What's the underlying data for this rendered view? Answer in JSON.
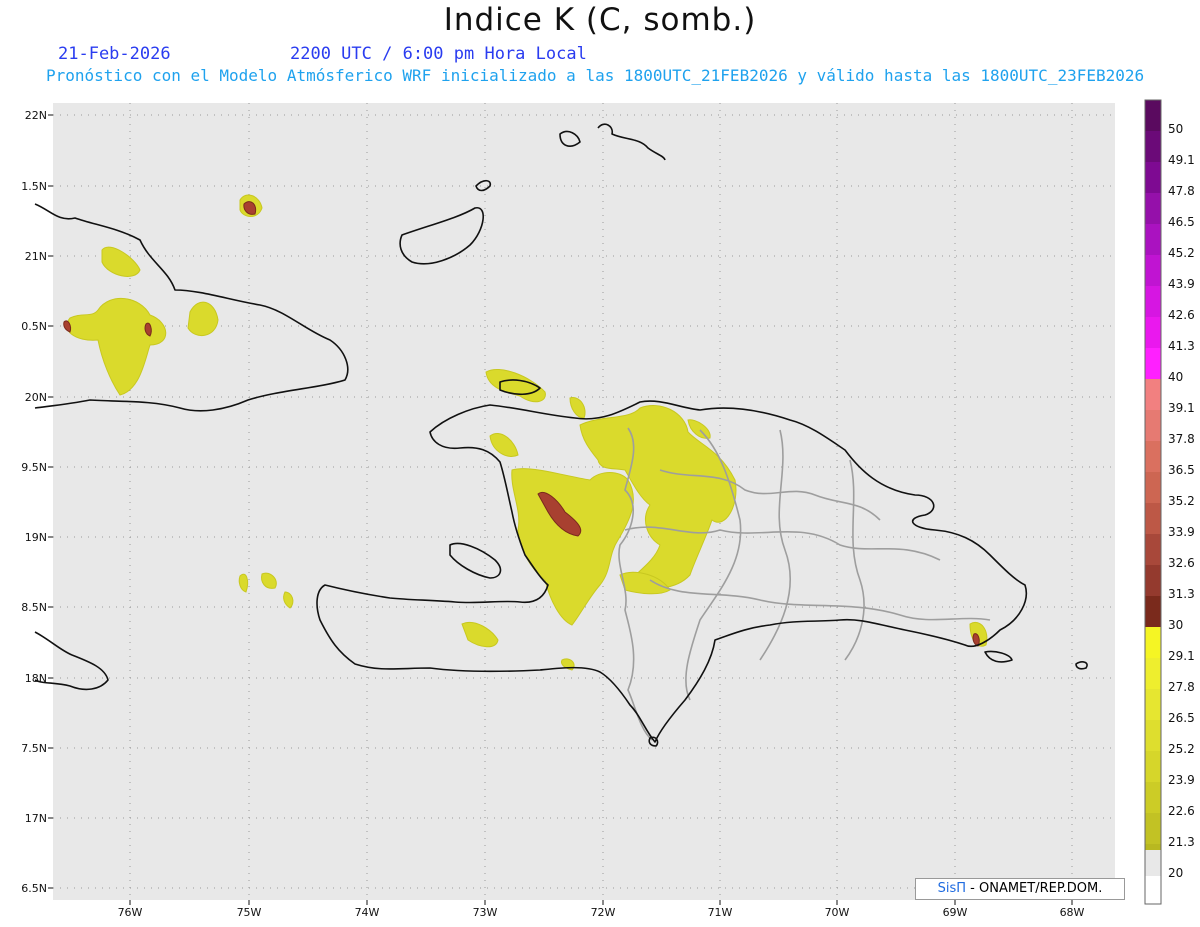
{
  "header": {
    "title": "Indice K (C, somb.)",
    "date": "21-Feb-2026",
    "time": "2200 UTC / 6:00 pm Hora Local",
    "subtitle": "Pronóstico con el Modelo Atmósferico WRF inicializado a las 1800UTC_21FEB2026 y válido hasta las  1800UTC_23FEB2026"
  },
  "axes": {
    "lat_labels": [
      "22N",
      "1.5N",
      "21N",
      "0.5N",
      "20N",
      "9.5N",
      "19N",
      "8.5N",
      "18N",
      "7.5N",
      "17N",
      "6.5N"
    ],
    "lon_labels": [
      "76W",
      "75W",
      "74W",
      "73W",
      "72W",
      "71W",
      "70W",
      "69W",
      "68W"
    ]
  },
  "colorbar": {
    "labels": [
      "50",
      "49.1",
      "47.8",
      "46.5",
      "45.2",
      "43.9",
      "42.6",
      "41.3",
      "40",
      "39.1",
      "37.8",
      "36.5",
      "35.2",
      "33.9",
      "32.6",
      "31.3",
      "30",
      "29.1",
      "27.8",
      "26.5",
      "25.2",
      "23.9",
      "22.6",
      "21.3",
      "20"
    ],
    "colors": [
      "#5a0a5f",
      "#6b0a78",
      "#7e0a92",
      "#9510aa",
      "#aa12c0",
      "#c014d2",
      "#d616e2",
      "#ea18ee",
      "#ff20ff",
      "#f28080",
      "#e67a72",
      "#da705f",
      "#cd6652",
      "#bd5846",
      "#a8483a",
      "#943a2e",
      "#7a2a1c",
      "#f5f524",
      "#eeee2e",
      "#e6e630",
      "#dede2e",
      "#d6d62a",
      "#cccc26",
      "#c2c224",
      "#b8b820"
    ],
    "colors_note": ""
  },
  "credit": {
    "brand": "SisΠ",
    "text": "- ONAMET/REP.DOM."
  },
  "colors": {
    "map_background": "#e8e8e8",
    "date_text": "#2a3cf0",
    "subtitle_text": "#1fa2ee",
    "field_low": "#d8d830",
    "field_high": "#a03a2a"
  }
}
